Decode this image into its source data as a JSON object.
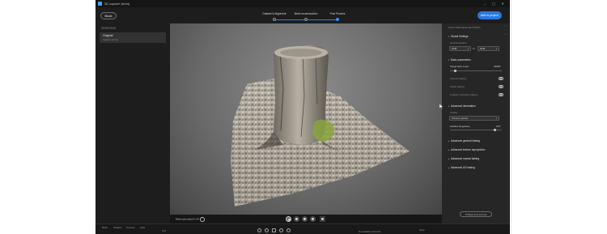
{
  "window": {
    "title": "3D capture (beta)",
    "controls": [
      "–",
      "▢",
      "✕"
    ]
  },
  "topbar": {
    "back_label": "Back",
    "steps": [
      {
        "label": "Dataset & Alignment",
        "active": true
      },
      {
        "label": "Mesh reconstruction",
        "active": true
      },
      {
        "label": "Post Process",
        "active": true
      }
    ],
    "add_label": "Add to project"
  },
  "left_panel": {
    "header": "VERSIONS",
    "version": {
      "title": "Original",
      "subtitle": "Capture 3d File"
    }
  },
  "viewport": {
    "mesh_text": "Mesh generated in 4h",
    "info_icon": "i"
  },
  "right_panel": {
    "header": "POST PROCESS SETTINGS",
    "global": {
      "title": "Global Settings",
      "resolution_label": "Grid Resolution",
      "res_a": "2048",
      "res_b": "2048"
    },
    "basic": {
      "title": "Basic parameters",
      "rows": [
        {
          "label": "Target face count",
          "value": "30000",
          "type": "slider",
          "fraction": 0.1
        },
        {
          "label": "Smooth baking",
          "type": "toggle"
        },
        {
          "label": "Depth baking",
          "type": "toggle"
        },
        {
          "label": "Ambient occlusion baking",
          "type": "toggle"
        }
      ]
    },
    "decimation": {
      "title": "Advanced decimation",
      "quality_label": "Quality",
      "quality_value": "Preserve planes",
      "regularity_label": "Surface Regularity",
      "regularity_value": "0.87",
      "regularity_fraction": 0.87
    },
    "collapsed_sections": [
      "Advanced general baking",
      "Advanced texture reprojection",
      "Advanced normal baking",
      "Advanced AO baking"
    ],
    "reset_label": "Reset post process"
  },
  "bottom_bar": {
    "tabs": [
      "Mesh",
      "Shaders",
      "Textures",
      "Light"
    ],
    "left_label": "Tips",
    "center_text": "No available elements",
    "right_text": "Open"
  },
  "colors": {
    "accent": "#2a78e0",
    "window_bg": "#1d1d1d",
    "panel_bg": "#262626"
  }
}
